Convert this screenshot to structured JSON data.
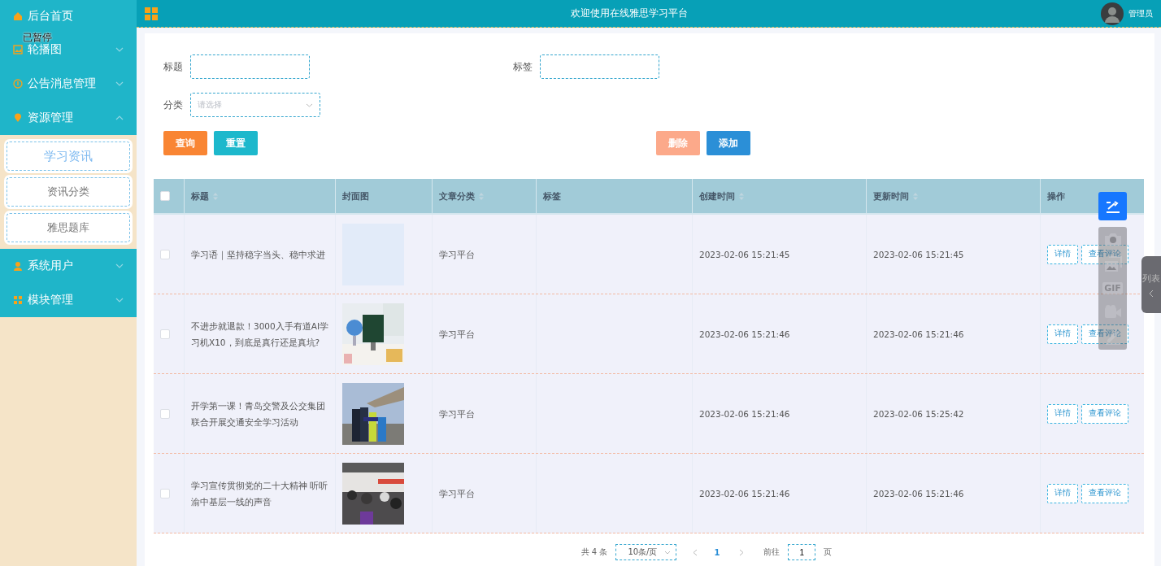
{
  "header": {
    "title": "欢迎使用在线雅思学习平台",
    "user": "管理员"
  },
  "paused_label": "已暂停",
  "menu": [
    {
      "label": "后台首页"
    },
    {
      "label": "轮播图",
      "expanded": false
    },
    {
      "label": "公告消息管理",
      "expanded": false
    },
    {
      "label": "资源管理",
      "expanded": true,
      "children": [
        {
          "label": "学习资讯",
          "selected": true
        },
        {
          "label": "资讯分类",
          "selected": false
        },
        {
          "label": "雅思题库",
          "selected": false
        }
      ]
    },
    {
      "label": "系统用户",
      "expanded": false
    },
    {
      "label": "模块管理",
      "expanded": false
    }
  ],
  "search": {
    "title_label": "标题",
    "tag_label": "标签",
    "category_label": "分类",
    "category_placeholder": "请选择"
  },
  "left_buttons": [
    {
      "label": "查询",
      "kind": "query"
    },
    {
      "label": "重置",
      "kind": "reset"
    }
  ],
  "right_buttons": [
    {
      "label": "删除",
      "kind": "delete"
    },
    {
      "label": "添加",
      "kind": "add"
    }
  ],
  "table": {
    "select_all_checked": false,
    "columns": [
      {
        "label": "标题",
        "sortable": true
      },
      {
        "label": "封面图",
        "sortable": false
      },
      {
        "label": "文章分类",
        "sortable": true
      },
      {
        "label": "标签",
        "sortable": false
      },
      {
        "label": "创建时间",
        "sortable": true
      },
      {
        "label": "更新时间",
        "sortable": true
      },
      {
        "label": "操作",
        "sortable": false
      }
    ],
    "rows": [
      {
        "checked": false,
        "title": "学习语｜坚持稳字当头、稳中求进",
        "cover": {
          "kind": "empty"
        },
        "category": "学习平台",
        "created": "2023-02-06 15:21:45",
        "updated": "2023-02-06 15:21:45",
        "actions": [
          "详情",
          "查看评论"
        ]
      },
      {
        "checked": false,
        "title": "不进步就退款！3000入手有道AI学习机X10，到底是真行还是真坑?",
        "cover": {
          "kind": "picture"
        },
        "category": "学习平台",
        "created": "2023-02-06 15:21:46",
        "updated": "2023-02-06 15:21:46",
        "actions": [
          "详情",
          "查看评论"
        ]
      },
      {
        "checked": false,
        "title": "开学第一课！青岛交警及公交集团联合开展交通安全学习活动",
        "cover": {
          "kind": "picture"
        },
        "category": "学习平台",
        "created": "2023-02-06 15:21:46",
        "updated": "2023-02-06 15:25:42",
        "actions": [
          "详情",
          "查看评论"
        ]
      },
      {
        "checked": false,
        "title": "学习宣传贯彻党的二十大精神 听听渝中基层一线的声音",
        "cover": {
          "kind": "picture"
        },
        "category": "学习平台",
        "created": "2023-02-06 15:21:46",
        "updated": "2023-02-06 15:21:46",
        "actions": [
          "详情",
          "查看评论"
        ]
      }
    ]
  },
  "pagination": {
    "total": "共 4 条",
    "page_size": "10条/页",
    "current": "1",
    "goto_label": "前往",
    "goto_value": "1",
    "page_unit": "页"
  },
  "capture_tools": [
    {
      "kind": "share"
    },
    {
      "kind": "camera"
    },
    {
      "kind": "images"
    },
    {
      "kind": "gif",
      "label": "GIF"
    },
    {
      "kind": "video"
    },
    {
      "kind": "pen"
    }
  ],
  "side_tab": {
    "label": "列表"
  }
}
